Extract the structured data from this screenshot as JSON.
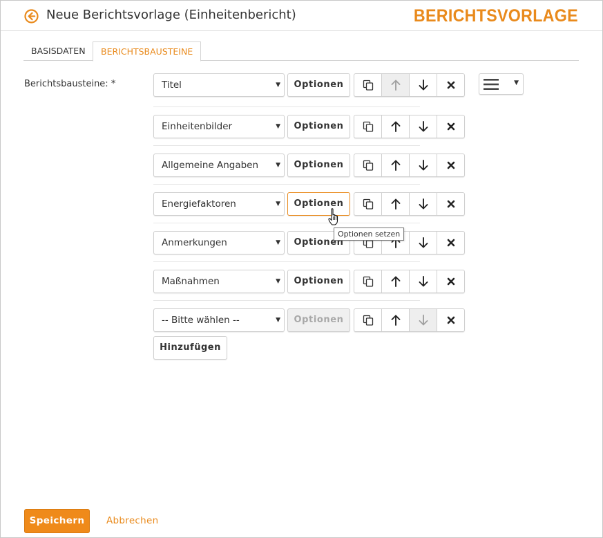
{
  "header": {
    "title": "Neue Berichtsvorlage (Einheitenbericht)",
    "brand": "BERICHTSVORLAGE",
    "back_icon": "arrow-left-circle-icon"
  },
  "tabs": [
    {
      "label": "BASISDATEN",
      "active": false
    },
    {
      "label": "BERICHTSBAUSTEINE",
      "active": true
    }
  ],
  "form": {
    "label": "Berichtsbausteine: *",
    "options_label": "Optionen",
    "rows": [
      {
        "selected": "Titel",
        "options_state": "normal",
        "up_disabled": true,
        "down_disabled": false
      },
      {
        "selected": "Einheitenbilder",
        "options_state": "normal",
        "up_disabled": false,
        "down_disabled": false
      },
      {
        "selected": "Allgemeine Angaben",
        "options_state": "normal",
        "up_disabled": false,
        "down_disabled": false
      },
      {
        "selected": "Energiefaktoren",
        "options_state": "focused",
        "up_disabled": false,
        "down_disabled": false
      },
      {
        "selected": "Anmerkungen",
        "options_state": "normal",
        "up_disabled": false,
        "down_disabled": false
      },
      {
        "selected": "Maßnahmen",
        "options_state": "normal",
        "up_disabled": false,
        "down_disabled": false
      },
      {
        "selected": "-- Bitte wählen --",
        "options_state": "disabled",
        "up_disabled": false,
        "down_disabled": true
      }
    ],
    "add_label": "Hinzufügen",
    "tooltip": "Optionen setzen"
  },
  "footer": {
    "save_label": "Speichern",
    "cancel_label": "Abbrechen"
  },
  "colors": {
    "accent": "#e98a1c",
    "save_button": "#ef8a1a"
  },
  "icons": [
    "copy-icon",
    "arrow-up-icon",
    "arrow-down-icon",
    "close-icon",
    "hamburger-icon",
    "hand-cursor-icon"
  ]
}
